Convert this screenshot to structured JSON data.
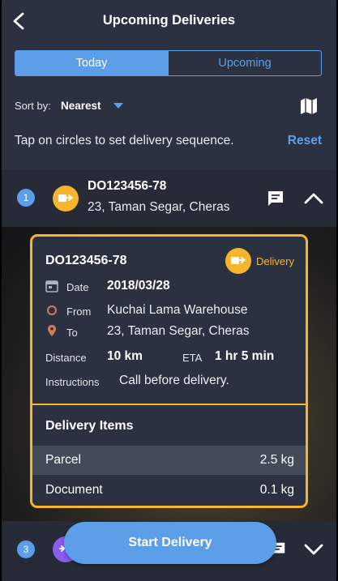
{
  "header": {
    "title": "Upcoming Deliveries"
  },
  "tabs": [
    {
      "label": "Today",
      "active": true
    },
    {
      "label": "Upcoming",
      "active": false
    }
  ],
  "sort": {
    "label": "Sort by:",
    "value": "Nearest"
  },
  "hint": {
    "text": "Tap on circles to set delivery sequence.",
    "reset_label": "Reset"
  },
  "row1": {
    "sequence": "1",
    "id": "DO123456-78",
    "address": "23, Taman Segar, Cheras"
  },
  "card": {
    "id": "DO123456-78",
    "type": "Delivery",
    "date_label": "Date",
    "date": "2018/03/28",
    "from_label": "From",
    "from": "Kuchai Lama Warehouse",
    "to_label": "To",
    "to": "23, Taman Segar, Cheras",
    "distance_label": "Distance",
    "distance": "10 km",
    "eta_label": "ETA",
    "eta": "1 hr 5 min",
    "instructions_label": "Instructions",
    "instructions": "Call before delivery.",
    "items_title": "Delivery Items",
    "items": [
      {
        "name": "Parcel",
        "weight": "2.5  kg"
      },
      {
        "name": "Document",
        "weight": "0.1 kg"
      }
    ]
  },
  "row3": {
    "sequence": "3"
  },
  "cta": {
    "label": "Start Delivery"
  },
  "colors": {
    "accent": "#5c9fe8",
    "delivery": "#f7b52c",
    "pickup": "#8a5cf0",
    "background": "#2b3140"
  },
  "icons": [
    "back-arrow-icon",
    "map-icon",
    "truck-icon",
    "chat-icon",
    "chevron-up-icon",
    "chevron-down-icon",
    "calendar-icon",
    "origin-circle-icon",
    "location-pin-icon"
  ]
}
